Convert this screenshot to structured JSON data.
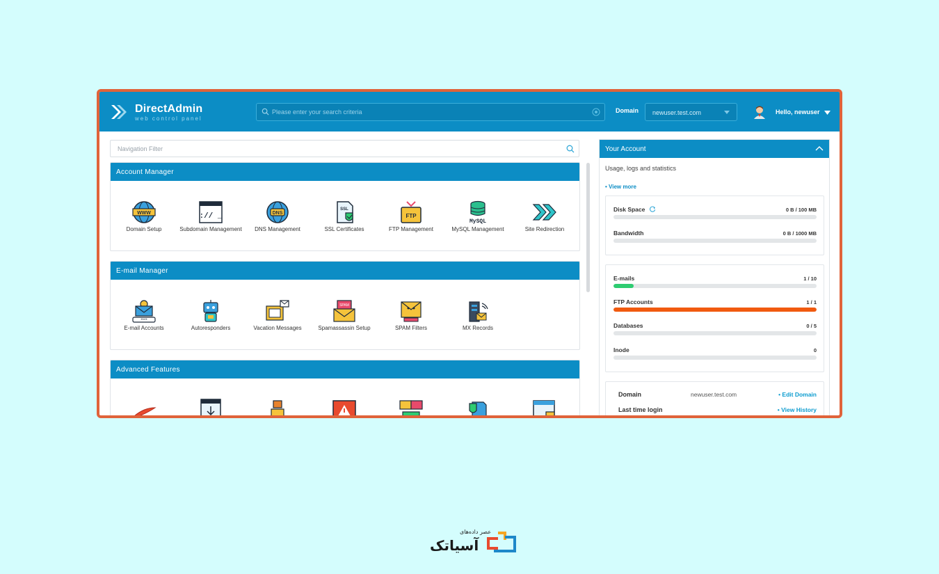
{
  "app": {
    "title": "DirectAdmin",
    "subtitle": "web control panel"
  },
  "search": {
    "placeholder": "Please enter your search criteria"
  },
  "domain": {
    "label": "Domain",
    "selected": "newuser.test.com"
  },
  "user": {
    "greeting": "Hello, newuser"
  },
  "nav_filter": {
    "placeholder": "Navigation Filter"
  },
  "sections": [
    {
      "title": "Account Manager",
      "items": [
        {
          "label": "Domain Setup",
          "icon": "www-globe-icon"
        },
        {
          "label": "Subdomain Management",
          "icon": "terminal-window-icon"
        },
        {
          "label": "DNS Management",
          "icon": "dns-globe-icon"
        },
        {
          "label": "SSL Certificates",
          "icon": "ssl-certificate-icon"
        },
        {
          "label": "FTP Management",
          "icon": "ftp-folder-icon"
        },
        {
          "label": "MySQL Management",
          "icon": "mysql-database-icon"
        },
        {
          "label": "Site Redirection",
          "icon": "double-arrow-icon"
        }
      ]
    },
    {
      "title": "E-mail Manager",
      "items": [
        {
          "label": "E-mail Accounts",
          "icon": "email-account-icon"
        },
        {
          "label": "Autoresponders",
          "icon": "robot-icon"
        },
        {
          "label": "Vacation Messages",
          "icon": "vacation-mail-icon"
        },
        {
          "label": "Spamassassin Setup",
          "icon": "spam-envelope-icon"
        },
        {
          "label": "SPAM Filters",
          "icon": "spam-filter-icon"
        },
        {
          "label": "MX Records",
          "icon": "mx-server-icon"
        }
      ]
    },
    {
      "title": "Advanced Features",
      "items": [
        {
          "label": "",
          "icon": "apache-feather-icon"
        },
        {
          "label": "",
          "icon": "download-window-icon"
        },
        {
          "label": "",
          "icon": "robot-worker-icon"
        },
        {
          "label": "",
          "icon": "warning-window-icon"
        },
        {
          "label": "",
          "icon": "chat-monitor-icon"
        },
        {
          "label": "",
          "icon": "shield-file-icon"
        },
        {
          "label": "",
          "icon": "locked-window-icon"
        }
      ]
    }
  ],
  "account": {
    "title": "Your Account",
    "subtitle": "Usage, logs and statistics",
    "view_more": "• View more",
    "usage": [
      {
        "name": "Disk Space",
        "value": "0 B / 100 MB",
        "fraction": 0,
        "color": "#2ecc71"
      },
      {
        "name": "Bandwidth",
        "value": "0 B / 1000 MB",
        "fraction": 0,
        "color": "#2ecc71"
      }
    ],
    "counts": [
      {
        "name": "E-mails",
        "value": "1 / 10",
        "fraction": 0.1,
        "color": "#2ecc71"
      },
      {
        "name": "FTP Accounts",
        "value": "1 / 1",
        "fraction": 1,
        "color": "#f15a0f"
      },
      {
        "name": "Databases",
        "value": "0 / 5",
        "fraction": 0,
        "color": "#2ecc71"
      },
      {
        "name": "Inode",
        "value": "0",
        "fraction": 0,
        "color": "#2ecc71"
      }
    ],
    "info": [
      {
        "key": "Domain",
        "value": "newuser.test.com",
        "action": "• Edit Domain"
      },
      {
        "key": "Last time login",
        "value": "",
        "action": "• View History"
      }
    ]
  },
  "brand": {
    "tagline": "عصر داده‌های",
    "name": "آسیاتک"
  },
  "colors": {
    "header": "#0c8dc5",
    "frame": "#e0633a",
    "background": "#d4fdfd"
  }
}
